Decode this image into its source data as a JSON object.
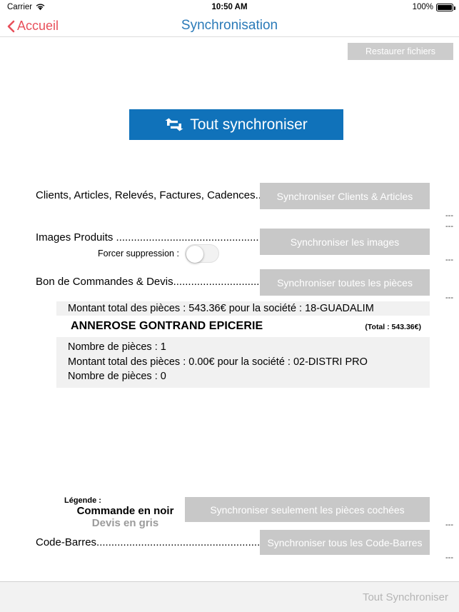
{
  "status_bar": {
    "carrier": "Carrier",
    "wifi_icon": "wifi-icon",
    "time": "10:50 AM",
    "battery_percent": "100%",
    "battery_icon": "battery-full-icon"
  },
  "nav_bar": {
    "back_icon": "chevron-left-icon",
    "back_label": "Accueil",
    "title": "Synchronisation",
    "title_color": "#2a7ab8",
    "back_color": "#e8505b"
  },
  "toolbar": {
    "restore_label": "Restaurer fichiers",
    "restore_disabled": true
  },
  "primary_action": {
    "icon": "retweet-sync-icon",
    "label": "Tout synchroniser",
    "color": "#1072ba"
  },
  "rows": [
    {
      "label": "Clients, Articles, Relevés, Factures, Cadences......",
      "button": "Synchroniser Clients & Articles",
      "status": [
        "---",
        "---"
      ]
    },
    {
      "label": "Images Produits .............................................................",
      "button": "Synchroniser les images",
      "status": [
        "---"
      ],
      "toggle_label": "Forcer suppression :",
      "toggle_state": "off"
    },
    {
      "label": "Bon de Commandes & Devis.................................",
      "button": "Synchroniser toutes les pièces",
      "status": [
        "---"
      ]
    }
  ],
  "totals": {
    "line_1": "Montant total des pièces : 543.36€ pour la société : 18-GUADALIM",
    "company_name": "ANNEROSE GONTRAND EPICERIE",
    "company_total": "(Total : 543.36€)",
    "line_2": "Nombre de pièces : 1",
    "line_3": "Montant total des pièces : 0.00€ pour la société : 02-DISTRI PRO",
    "line_4": "Nombre de pièces : 0"
  },
  "legend": {
    "title": "Légende :",
    "noir": "Commande en noir",
    "gris": "Devis en gris",
    "gris_color": "#9b9b9b"
  },
  "checked_row": {
    "button": "Synchroniser seulement les pièces cochées",
    "status": "---"
  },
  "barcode_row": {
    "label": "Code-Barres.........................................................",
    "button": "Synchroniser tous les Code-Barres",
    "status": "---"
  },
  "bottom_bar": {
    "label": "Tout Synchroniser"
  }
}
